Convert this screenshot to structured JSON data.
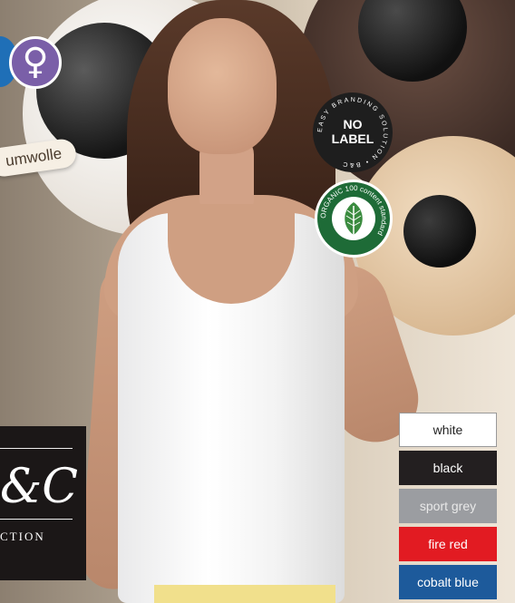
{
  "badges": {
    "gender_symbol": "♀",
    "fabric_text": "umwolle",
    "nolabel": {
      "ring_text": "EASY BRANDING SOLUTION • B&C",
      "line1": "NO",
      "line2": "LABEL"
    },
    "organic": {
      "ring_text": "ORGANIC 100 content standard",
      "icon": "leaf-icon"
    }
  },
  "collection": {
    "monogram": "&C",
    "wordmark": "CTION"
  },
  "swatches": [
    {
      "label": "white",
      "color": "#ffffff"
    },
    {
      "label": "black",
      "color": "#231f20"
    },
    {
      "label": "sport grey",
      "color": "#9b9da1"
    },
    {
      "label": "fire red",
      "color": "#e21b22"
    },
    {
      "label": "cobalt blue",
      "color": "#1d5a9b"
    }
  ]
}
